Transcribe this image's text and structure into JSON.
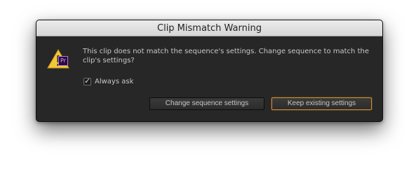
{
  "dialog": {
    "title": "Clip Mismatch Warning",
    "message": "This clip does not match the sequence's settings. Change sequence to match the clip's settings?",
    "app_badge": "Pr",
    "checkbox": {
      "label": "Always ask",
      "checked": true
    },
    "buttons": {
      "change_label": "Change sequence settings",
      "keep_label": "Keep existing settings"
    },
    "colors": {
      "background": "#272727",
      "focus_outline": "#d08a2a",
      "warning_icon": "#f3c737"
    },
    "icons": [
      "warning-icon",
      "premiere-pro-icon",
      "checkmark-icon"
    ]
  }
}
